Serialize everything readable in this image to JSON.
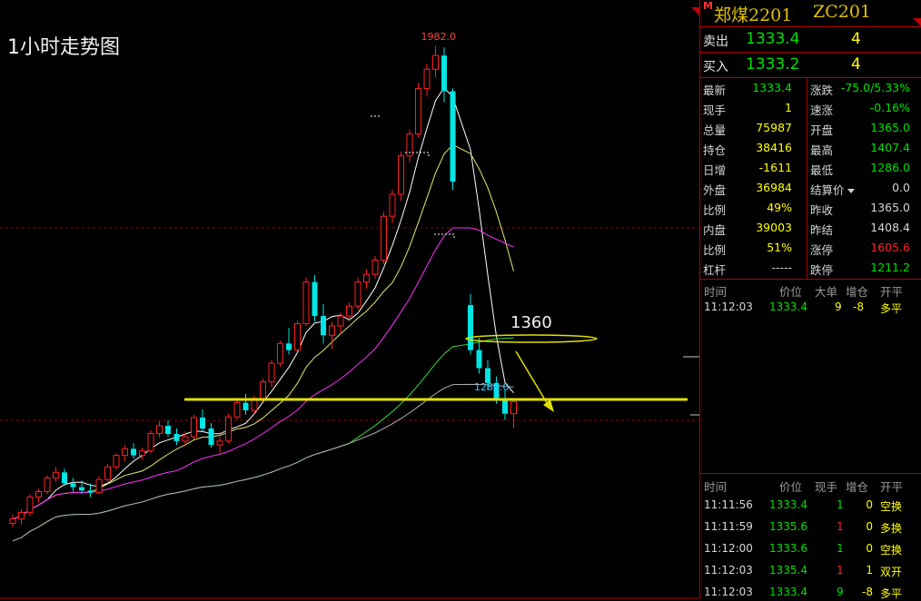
{
  "chart_title": "1小时走势图",
  "annotations": {
    "high_label": "1982.0",
    "low_label": "1286.0",
    "level_label": "1360"
  },
  "colors": {
    "up": "#ff2020",
    "down": "#00e5e5",
    "ma5": "#ffffff",
    "ma10": "#e8e870",
    "ma20": "#ff30ff",
    "ma40": "#30e030",
    "ma60": "#b0b0b0",
    "trendline": "#e0e000",
    "panel_border": "#b40000",
    "price_green": "#00e000",
    "price_red": "#ff2020",
    "volume_yellow": "#ffff00"
  },
  "chart_data": {
    "type": "candlestick",
    "title": "1小时走势图",
    "ohlc": [
      [
        1112,
        1128,
        1105,
        1120
      ],
      [
        1120,
        1138,
        1110,
        1132
      ],
      [
        1132,
        1165,
        1125,
        1160
      ],
      [
        1160,
        1175,
        1150,
        1170
      ],
      [
        1170,
        1200,
        1165,
        1195
      ],
      [
        1195,
        1215,
        1188,
        1205
      ],
      [
        1205,
        1212,
        1180,
        1185
      ],
      [
        1185,
        1195,
        1170,
        1178
      ],
      [
        1178,
        1190,
        1165,
        1172
      ],
      [
        1172,
        1185,
        1160,
        1168
      ],
      [
        1168,
        1198,
        1165,
        1192
      ],
      [
        1192,
        1220,
        1188,
        1215
      ],
      [
        1215,
        1240,
        1210,
        1236
      ],
      [
        1236,
        1255,
        1225,
        1248
      ],
      [
        1248,
        1258,
        1230,
        1236
      ],
      [
        1236,
        1250,
        1228,
        1244
      ],
      [
        1244,
        1282,
        1240,
        1276
      ],
      [
        1276,
        1298,
        1268,
        1290
      ],
      [
        1290,
        1300,
        1270,
        1275
      ],
      [
        1275,
        1285,
        1255,
        1262
      ],
      [
        1262,
        1280,
        1252,
        1270
      ],
      [
        1270,
        1310,
        1265,
        1305
      ],
      [
        1305,
        1320,
        1280,
        1285
      ],
      [
        1285,
        1295,
        1250,
        1255
      ],
      [
        1255,
        1270,
        1240,
        1262
      ],
      [
        1262,
        1312,
        1258,
        1306
      ],
      [
        1306,
        1338,
        1300,
        1332
      ],
      [
        1332,
        1348,
        1310,
        1318
      ],
      [
        1318,
        1345,
        1312,
        1340
      ],
      [
        1340,
        1376,
        1334,
        1370
      ],
      [
        1370,
        1410,
        1360,
        1404
      ],
      [
        1404,
        1445,
        1398,
        1440
      ],
      [
        1440,
        1468,
        1420,
        1428
      ],
      [
        1428,
        1482,
        1425,
        1476
      ],
      [
        1476,
        1560,
        1472,
        1552
      ],
      [
        1552,
        1565,
        1480,
        1490
      ],
      [
        1490,
        1512,
        1440,
        1455
      ],
      [
        1455,
        1480,
        1430,
        1472
      ],
      [
        1472,
        1496,
        1458,
        1490
      ],
      [
        1490,
        1515,
        1480,
        1508
      ],
      [
        1508,
        1560,
        1502,
        1552
      ],
      [
        1552,
        1575,
        1540,
        1566
      ],
      [
        1566,
        1600,
        1558,
        1592
      ],
      [
        1592,
        1680,
        1585,
        1672
      ],
      [
        1672,
        1720,
        1660,
        1712
      ],
      [
        1712,
        1790,
        1700,
        1782
      ],
      [
        1782,
        1830,
        1770,
        1822
      ],
      [
        1822,
        1915,
        1815,
        1905
      ],
      [
        1905,
        1950,
        1890,
        1940
      ],
      [
        1940,
        1982,
        1925,
        1965
      ],
      [
        1965,
        1980,
        1880,
        1900
      ],
      [
        1900,
        1905,
        1720,
        1735
      ],
      [
        1510,
        1530,
        1420,
        1428
      ],
      [
        1428,
        1450,
        1385,
        1395
      ],
      [
        1395,
        1410,
        1355,
        1368
      ],
      [
        1368,
        1380,
        1330,
        1340
      ],
      [
        1340,
        1356,
        1300,
        1312
      ],
      [
        1312,
        1340,
        1286,
        1334
      ]
    ],
    "moving_averages": [
      "MA5",
      "MA10",
      "MA20",
      "MA40",
      "MA60"
    ],
    "levels": [
      1360,
      1334
    ],
    "high": 1982.0,
    "low": 1286.0
  },
  "panel": {
    "corner_mark": "M",
    "name": "郑煤2201",
    "code": "ZC201",
    "sell": {
      "label": "卖出",
      "price": "1333.4",
      "vol": "4"
    },
    "buy": {
      "label": "买入",
      "price": "1333.2",
      "vol": "4"
    },
    "stats_left": [
      {
        "label": "最新",
        "value": "1333.4",
        "color": "#00e000"
      },
      {
        "label": "现手",
        "value": "1",
        "color": "#ffff00"
      },
      {
        "label": "总量",
        "value": "75987",
        "color": "#ffff00"
      },
      {
        "label": "持仓",
        "value": "38416",
        "color": "#ffff00"
      },
      {
        "label": "日增",
        "value": "-1611",
        "color": "#ffff00"
      },
      {
        "label": "外盘",
        "value": "36984",
        "color": "#ffff00"
      },
      {
        "label": "比例",
        "value": "49%",
        "color": "#ffff00"
      },
      {
        "label": "内盘",
        "value": "39003",
        "color": "#ffff00"
      },
      {
        "label": "比例",
        "value": "51%",
        "color": "#ffff00"
      },
      {
        "label": "杠杆",
        "value": "-----",
        "color": "#d6d6d6"
      }
    ],
    "stats_right": [
      {
        "label": "涨跌",
        "value": "-75.0/5.33%",
        "color": "#00e000"
      },
      {
        "label": "速涨",
        "value": "-0.16%",
        "color": "#00e000"
      },
      {
        "label": "开盘",
        "value": "1365.0",
        "color": "#00e000"
      },
      {
        "label": "最高",
        "value": "1407.4",
        "color": "#00e000"
      },
      {
        "label": "最低",
        "value": "1286.0",
        "color": "#00e000"
      },
      {
        "label": "结算价",
        "value": "0.0",
        "color": "#d6d6d6"
      },
      {
        "label": "昨收",
        "value": "1365.0",
        "color": "#d6d6d6"
      },
      {
        "label": "昨结",
        "value": "1408.4",
        "color": "#d6d6d6"
      },
      {
        "label": "涨停",
        "value": "1605.6",
        "color": "#ff2020"
      },
      {
        "label": "跌停",
        "value": "1211.2",
        "color": "#00e000"
      }
    ],
    "tick_headers": [
      "时间",
      "价位",
      "大单",
      "增仓",
      "开平"
    ],
    "big_ticks": [
      {
        "time": "11:12:03",
        "price": "1333.4",
        "vol": "9",
        "chg": "-8",
        "type": "多平"
      }
    ],
    "tick_headers2": [
      "时间",
      "价位",
      "现手",
      "增仓",
      "开平"
    ],
    "ticks": [
      {
        "time": "11:11:56",
        "price": "1333.4",
        "vol": "1",
        "chg": "0",
        "type": "空换",
        "pc": "#00e000",
        "vc": "#00e000",
        "cc": "#ffff00"
      },
      {
        "time": "11:11:59",
        "price": "1335.6",
        "vol": "1",
        "chg": "0",
        "type": "多换",
        "pc": "#00e000",
        "vc": "#ff2020",
        "cc": "#ffff00"
      },
      {
        "time": "11:12:00",
        "price": "1333.6",
        "vol": "1",
        "chg": "0",
        "type": "空换",
        "pc": "#00e000",
        "vc": "#00e000",
        "cc": "#ffff00"
      },
      {
        "time": "11:12:03",
        "price": "1335.4",
        "vol": "1",
        "chg": "1",
        "type": "双开",
        "pc": "#00e000",
        "vc": "#ff2020",
        "cc": "#ffff00"
      },
      {
        "time": "11:12:03",
        "price": "1333.4",
        "vol": "9",
        "chg": "-8",
        "type": "多平",
        "pc": "#00e000",
        "vc": "#00e000",
        "cc": "#ffff00"
      }
    ]
  }
}
